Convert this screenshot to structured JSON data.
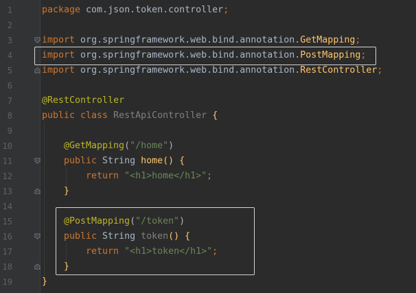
{
  "editor": {
    "line_numbers": [
      "1",
      "2",
      "3",
      "4",
      "5",
      "6",
      "7",
      "8",
      "9",
      "10",
      "11",
      "12",
      "13",
      "14",
      "15",
      "16",
      "17",
      "18",
      "19"
    ],
    "tokens": {
      "l1_kw": "package",
      "l1_pkg": " com.json.token.controller",
      "l1_semi": ";",
      "l3_kw": "import",
      "l3_path": " org.springframework.web.bind.annotation.",
      "l3_cls": "GetMapping",
      "l3_semi": ";",
      "l4_kw": "import",
      "l4_path": " org.springframework.web.bind.annotation.",
      "l4_cls": "PostMapping",
      "l4_semi": ";",
      "l5_kw": "import",
      "l5_path": " org.springframework.web.bind.annotation.",
      "l5_cls": "RestController",
      "l5_semi": ";",
      "l7_ann": "@RestController",
      "l8_kw": "public class",
      "l8_cls": " RestApiController ",
      "l8_brace": "{",
      "l10_ann": "@GetMapping",
      "l10_paren_open": "(",
      "l10_str": "\"/home\"",
      "l10_paren_close": ")",
      "l11_kw": "public",
      "l11_type": " String ",
      "l11_fn": "home",
      "l11_parens": "()",
      "l11_brace": " {",
      "l12_kw": "return",
      "l12_str": " \"<h1>home</h1>\"",
      "l12_semi": ";",
      "l13_brace": "}",
      "l15_ann": "@PostMapping",
      "l15_paren_open": "(",
      "l15_str": "\"/token\"",
      "l15_paren_close": ")",
      "l16_kw": "public",
      "l16_type": " String ",
      "l16_fn": "token",
      "l16_parens": "()",
      "l16_brace": " {",
      "l17_kw": "return",
      "l17_str": " \"<h1>token</h1>\"",
      "l17_semi": ";",
      "l18_brace": "}",
      "l19_brace": "}"
    },
    "colors": {
      "background": "#2b2b2b",
      "gutter": "#313335",
      "keyword": "#cc7832",
      "annotation": "#bbb529",
      "string": "#6a8759",
      "method": "#ffc66d",
      "plain": "#a9b7c6",
      "line_number": "#606366",
      "highlight_box": "#d4d4d4"
    },
    "fold_icons": [
      "fold-marker-icon",
      "fold-end-icon"
    ]
  }
}
